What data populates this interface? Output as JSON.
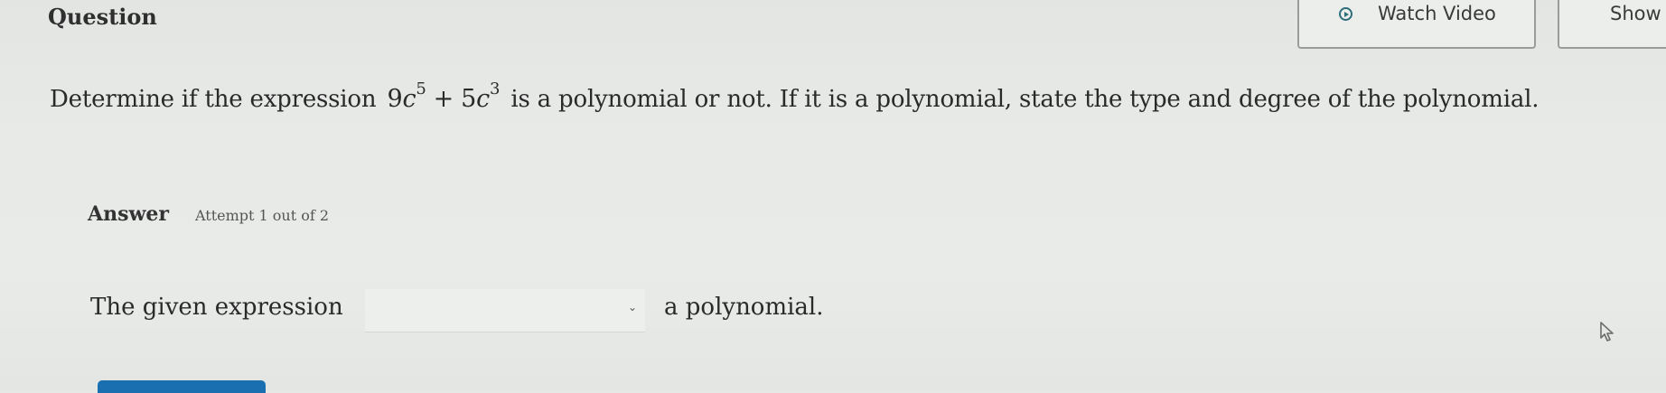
{
  "header": {
    "question_label": "Question",
    "watch_video_label": "Watch Video",
    "show_examples_label": "Show E"
  },
  "prompt": {
    "before": "Determine if the expression",
    "math": {
      "term1_coef": "9",
      "term1_var": "c",
      "term1_exp": "5",
      "operator": "+",
      "term2_coef": "5",
      "term2_var": "c",
      "term2_exp": "3"
    },
    "after": "is a polynomial or not. If it is a polynomial, state the type and degree of the polynomial."
  },
  "answer": {
    "label": "Answer",
    "attempt": "Attempt 1 out of 2",
    "sentence_before": "The given expression",
    "dropdown_value": "",
    "sentence_after": "a polynomial."
  },
  "icons": {
    "watch_video": "play-circle-icon",
    "dropdown": "chevron-down-icon",
    "cursor": "mouse-pointer-icon"
  },
  "colors": {
    "accent_teal": "#2e6e7a",
    "submit_blue": "#1a6fb0"
  }
}
